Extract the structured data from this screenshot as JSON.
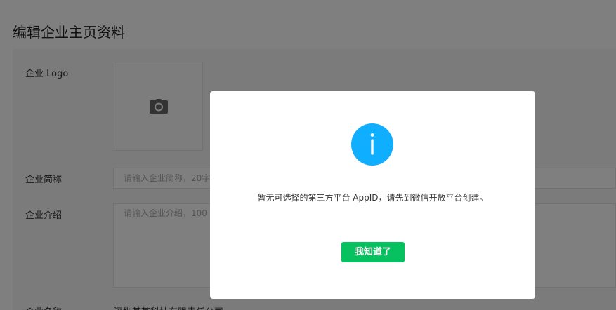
{
  "page": {
    "title": "编辑企业主页资料"
  },
  "form": {
    "logo_label": "企业 Logo",
    "logo_upload_icon": "camera-icon",
    "short_name_label": "企业简称",
    "short_name_placeholder": "请输入企业简称，20字",
    "intro_label": "企业介绍",
    "intro_placeholder": "请输入企业介绍，100",
    "company_name_label": "企业名称",
    "company_name_value": "深圳某某科技有限责任公司"
  },
  "modal": {
    "icon": "info-icon",
    "icon_color": "#10aeff",
    "message": "暂无可选择的第三方平台 AppID，请先到微信开放平台创建。",
    "confirm_label": "我知道了",
    "confirm_color": "#07c160"
  }
}
